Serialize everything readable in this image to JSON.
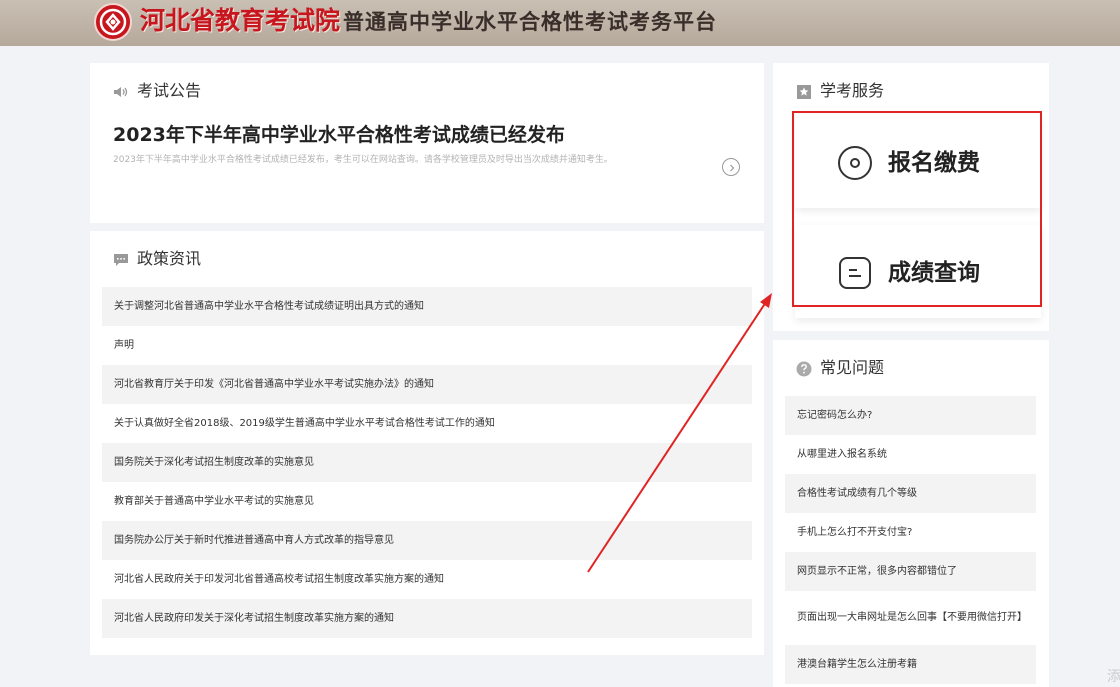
{
  "header": {
    "logo_text": "河北省教育考试院",
    "platform_title": "普通高中学业水平合格性考试考务平台"
  },
  "announcement": {
    "section_title": "考试公告",
    "headline": "2023年下半年高中学业水平合格性考试成绩已经发布",
    "summary": "2023年下半年高中学业水平合格性考试成绩已经发布，考生可以在网站查询。请各学校管理员及时导出当次成绩并通知考生。"
  },
  "policy": {
    "section_title": "政策资讯",
    "items": [
      "关于调整河北省普通高中学业水平合格性考试成绩证明出具方式的通知",
      "声明",
      "河北省教育厅关于印发《河北省普通高中学业水平考试实施办法》的通知",
      "关于认真做好全省2018级、2019级学生普通高中学业水平考试合格性考试工作的通知",
      "国务院关于深化考试招生制度改革的实施意见",
      "教育部关于普通高中学业水平考试的实施意见",
      "国务院办公厅关于新时代推进普通高中育人方式改革的指导意见",
      "河北省人民政府关于印发河北省普通高校考试招生制度改革实施方案的通知",
      "河北省人民政府印发关于深化考试招生制度改革实施方案的通知"
    ]
  },
  "service": {
    "section_title": "学考服务",
    "register_pay_label": "报名缴费",
    "score_query_label": "成绩查询"
  },
  "faq": {
    "section_title": "常见问题",
    "items": [
      "忘记密码怎么办?",
      "从哪里进入报名系统",
      "合格性考试成绩有几个等级",
      "手机上怎么打不开支付宝?",
      "网页显示不正常，很多内容都错位了",
      "页面出现一大串网址是怎么回事【不要用微信打开】",
      "港澳台籍学生怎么注册考籍"
    ]
  },
  "watermark": "添",
  "colors": {
    "brand_red": "#c7161d",
    "header_bg": "#bdb2a5",
    "highlight_red": "#e02424"
  }
}
